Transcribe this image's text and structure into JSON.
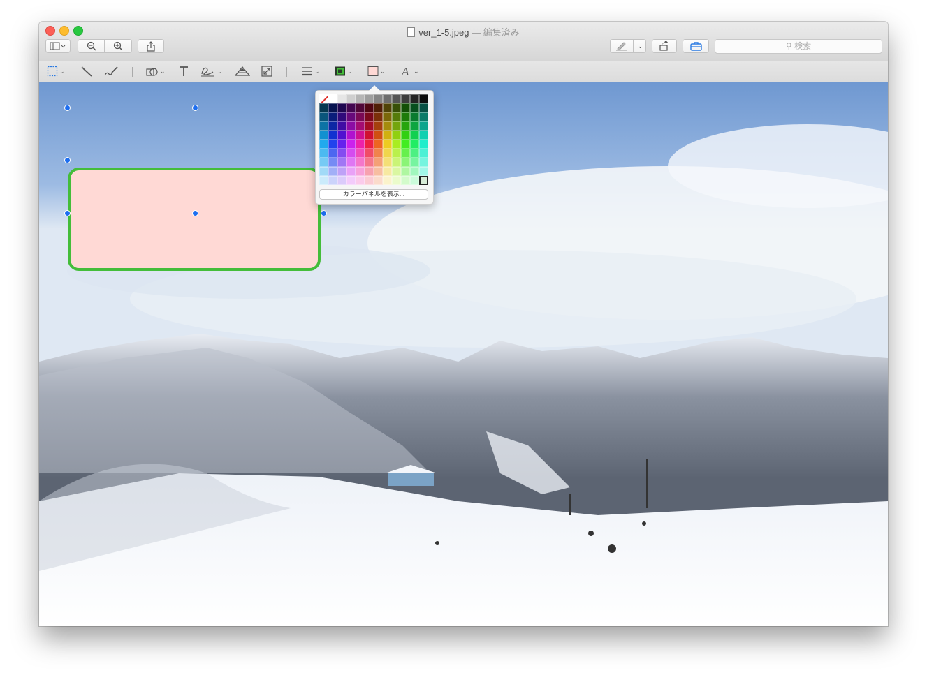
{
  "window": {
    "title": "ver_1-5.jpeg",
    "separator": "—",
    "status": "編集済み"
  },
  "search": {
    "placeholder": "検索",
    "icon": "magnifier-icon"
  },
  "toolbar": {
    "left": [
      "sidebar-toggle",
      "zoom-out",
      "zoom-in",
      "share"
    ],
    "right": [
      "markup-pen",
      "markup-menu",
      "rotate",
      "toolbox"
    ]
  },
  "markup_tools": [
    "rect-select",
    "instant-alpha",
    "sketch",
    "shapes",
    "text",
    "sign",
    "adjust-color",
    "adjust-size",
    "shape-style",
    "border-color",
    "fill-color",
    "text-style"
  ],
  "colors": {
    "shape_fill": "#ffd9d5",
    "shape_border": "#44bd3a",
    "handle": "#1d6ef0",
    "selected_swatch": "#d7ecd7"
  },
  "color_panel_button": "カラーパネルを表示..."
}
